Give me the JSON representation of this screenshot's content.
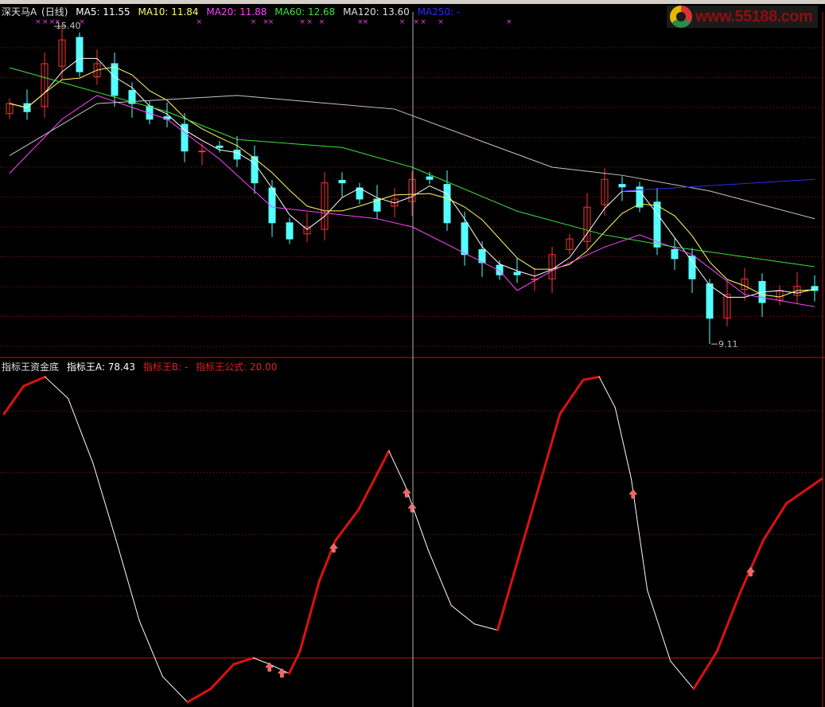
{
  "header": {
    "stock": "深天马A",
    "period": "(日线)",
    "ma5": "MA5: 11.55",
    "ma10": "MA10: 11.84",
    "ma20": "MA20: 11.88",
    "ma60": "MA60: 12.68",
    "ma120": "MA120: 13.60",
    "ma250": "MA250: -"
  },
  "logo": {
    "text": "www.55188.com"
  },
  "indicator_header": {
    "name": "指标王资金底",
    "a": "指标王A: 78.43",
    "b": "指标王B: -",
    "formula": "指标王公式: 20.00"
  },
  "colors": {
    "up": "#ff3232",
    "down": "#54ffff",
    "ma5": "#ffffff",
    "ma10": "#ffff64",
    "ma20": "#ff44ff",
    "ma60": "#40e040",
    "ma120": "#c8c8c8",
    "ma250": "#2a2aff",
    "grid": "#a01010",
    "rise": "#dd1111",
    "fall": "#ffffff"
  },
  "chart_data": [
    {
      "type": "candlestick",
      "title": "深天马A (日线)",
      "annotations": {
        "high_label": "15.40",
        "low_label": "9.11"
      },
      "ylim": [
        9.0,
        15.6
      ],
      "closes": [
        13.87,
        13.71,
        14.66,
        15.13,
        14.5,
        14.66,
        14.03,
        13.87,
        13.56,
        13.56,
        12.93,
        12.93,
        13.0,
        12.77,
        12.3,
        11.51,
        11.19,
        11.43,
        12.3,
        12.3,
        11.98,
        11.74,
        11.98,
        12.37,
        12.37,
        11.51,
        10.88,
        10.72,
        10.48,
        10.48,
        10.4,
        10.88,
        11.19,
        11.82,
        12.37,
        12.22,
        11.82,
        11.03,
        10.8,
        10.4,
        9.62,
        10.09,
        10.4,
        9.93,
        10.17,
        10.25,
        10.17
      ],
      "high_index": 3,
      "high_value": 15.4,
      "low_index": 40,
      "low_value": 9.11,
      "ma_series": [
        {
          "name": "MA20",
          "points": [
            [
              0,
              12.49
            ],
            [
              3,
              13.56
            ],
            [
              5,
              14.03
            ],
            [
              9,
              13.56
            ],
            [
              12,
              12.77
            ],
            [
              15,
              11.82
            ],
            [
              21,
              11.59
            ],
            [
              23,
              11.43
            ],
            [
              28,
              10.56
            ],
            [
              29,
              10.17
            ],
            [
              31,
              10.56
            ],
            [
              34,
              11.03
            ],
            [
              36,
              11.27
            ],
            [
              39,
              10.88
            ],
            [
              42,
              10.09
            ],
            [
              46,
              9.85
            ]
          ]
        },
        {
          "name": "MA60",
          "points": [
            [
              0,
              14.58
            ],
            [
              4,
              14.19
            ],
            [
              9,
              13.71
            ],
            [
              13,
              13.16
            ],
            [
              19,
              13.0
            ],
            [
              23,
              12.61
            ],
            [
              29,
              11.74
            ],
            [
              34,
              11.27
            ],
            [
              38,
              11.03
            ],
            [
              46,
              10.64
            ]
          ]
        },
        {
          "name": "MA120",
          "points": [
            [
              0,
              12.84
            ],
            [
              5,
              13.87
            ],
            [
              13,
              14.03
            ],
            [
              22,
              13.76
            ],
            [
              31,
              12.61
            ],
            [
              35,
              12.45
            ],
            [
              40,
              12.14
            ],
            [
              46,
              11.59
            ]
          ]
        },
        {
          "name": "MA250",
          "points": [
            [
              35,
              12.14
            ],
            [
              46,
              12.37
            ]
          ]
        }
      ],
      "signal_markers": [
        1.6,
        2,
        2.4,
        2.7,
        4.1,
        10.8,
        13.9,
        14.6,
        14.9,
        16.7,
        17.1,
        17.8,
        20,
        20.3,
        22.4,
        23.2,
        23.6,
        24.6,
        28.5
      ]
    },
    {
      "type": "line",
      "title": "指标王资金底",
      "ylim": [
        0,
        115
      ],
      "gridlines": [
        40,
        60,
        80,
        100
      ],
      "reference_line": 20,
      "x": [
        0,
        1.1,
        2.3,
        3.6,
        5,
        6.3,
        7.6,
        8.9,
        10.3,
        11.6,
        12.9,
        14,
        14.9,
        16,
        16.6,
        17.7,
        18.6,
        19.9,
        20.8,
        21.6,
        22.5,
        23.8,
        25.1,
        26.4,
        27.7,
        28.6,
        29.9,
        31.2,
        32.5,
        33.4,
        34.3,
        35.2,
        36.1,
        37.4,
        38.7,
        40,
        41.3,
        42.6,
        43.9,
        45.9
      ],
      "values": [
        99,
        108,
        111,
        104,
        83,
        58,
        32,
        14,
        5.7,
        10,
        18,
        20,
        18,
        15,
        22,
        45,
        58,
        68,
        78,
        87,
        76,
        55,
        37,
        31,
        29,
        47,
        73,
        99,
        110,
        111,
        101,
        78,
        42,
        19,
        10,
        22,
        41,
        58,
        70,
        78
      ],
      "up_arrows": [
        14.9,
        15.6,
        18.5,
        22.6,
        22.9,
        35.3,
        41.9
      ]
    }
  ]
}
